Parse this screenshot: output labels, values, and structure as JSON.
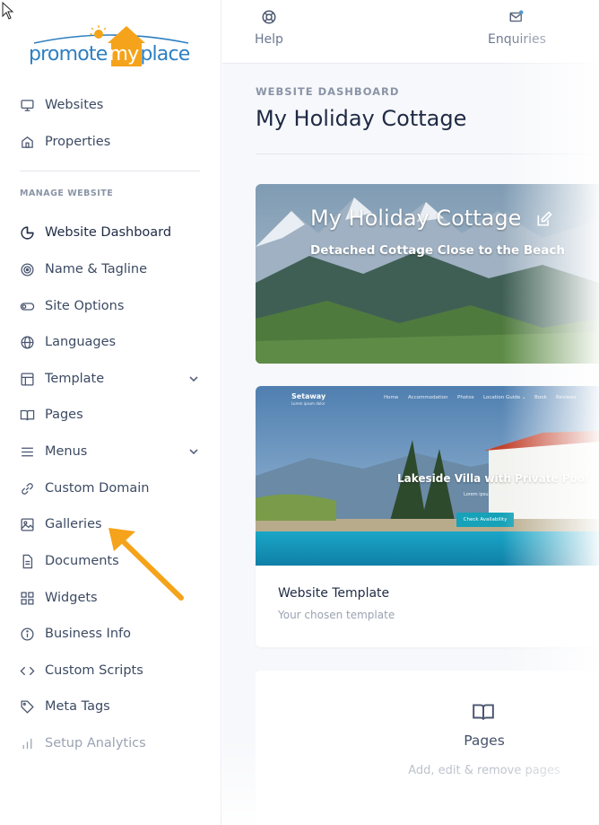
{
  "brand": {
    "part1": "promote",
    "part2": "my",
    "part3": "place"
  },
  "sidebar": {
    "top_items": [
      {
        "label": "Websites",
        "icon": "monitor-icon"
      },
      {
        "label": "Properties",
        "icon": "home-icon"
      }
    ],
    "section_label": "MANAGE WEBSITE",
    "items": [
      {
        "label": "Website Dashboard",
        "icon": "pie-chart-icon"
      },
      {
        "label": "Name & Tagline",
        "icon": "target-icon"
      },
      {
        "label": "Site Options",
        "icon": "toggle-icon"
      },
      {
        "label": "Languages",
        "icon": "globe-icon"
      },
      {
        "label": "Template",
        "icon": "layout-icon"
      },
      {
        "label": "Pages",
        "icon": "book-icon"
      },
      {
        "label": "Menus",
        "icon": "menu-icon"
      },
      {
        "label": "Custom Domain",
        "icon": "link-icon"
      },
      {
        "label": "Galleries",
        "icon": "image-icon"
      },
      {
        "label": "Documents",
        "icon": "document-icon"
      },
      {
        "label": "Widgets",
        "icon": "grid-icon"
      },
      {
        "label": "Business Info",
        "icon": "info-icon"
      },
      {
        "label": "Custom Scripts",
        "icon": "code-icon"
      },
      {
        "label": "Meta Tags",
        "icon": "tag-icon"
      },
      {
        "label": "Setup Analytics",
        "icon": "bar-chart-icon"
      }
    ]
  },
  "topbar": {
    "help_label": "Help",
    "enquiries_label": "Enquiries"
  },
  "header": {
    "eyebrow": "WEBSITE DASHBOARD",
    "title": "My Holiday Cottage"
  },
  "hero": {
    "title": "My Holiday Cottage",
    "subtitle": "Detached Cottage Close to the Beach"
  },
  "template_card": {
    "preview": {
      "brand": "Setaway",
      "brand_sub": "Lorem ipsum dolor",
      "nav": [
        "Home",
        "Accommodation",
        "Photos",
        "Location Guide ⌄",
        "Book",
        "Reviews"
      ],
      "headline": "Lakeside Villa with Private Pool",
      "small": "Lorem ipsum dolor",
      "button": "Check Availability"
    },
    "title": "Website Template",
    "subtitle": "Your chosen template"
  },
  "pages_card": {
    "title": "Pages",
    "subtitle": "Add, edit & remove pages"
  },
  "colors": {
    "accent_blue": "#2e7fc1",
    "accent_orange": "#f5a31a",
    "arrow": "#f5a31a",
    "preview_button": "#16a2b8"
  }
}
